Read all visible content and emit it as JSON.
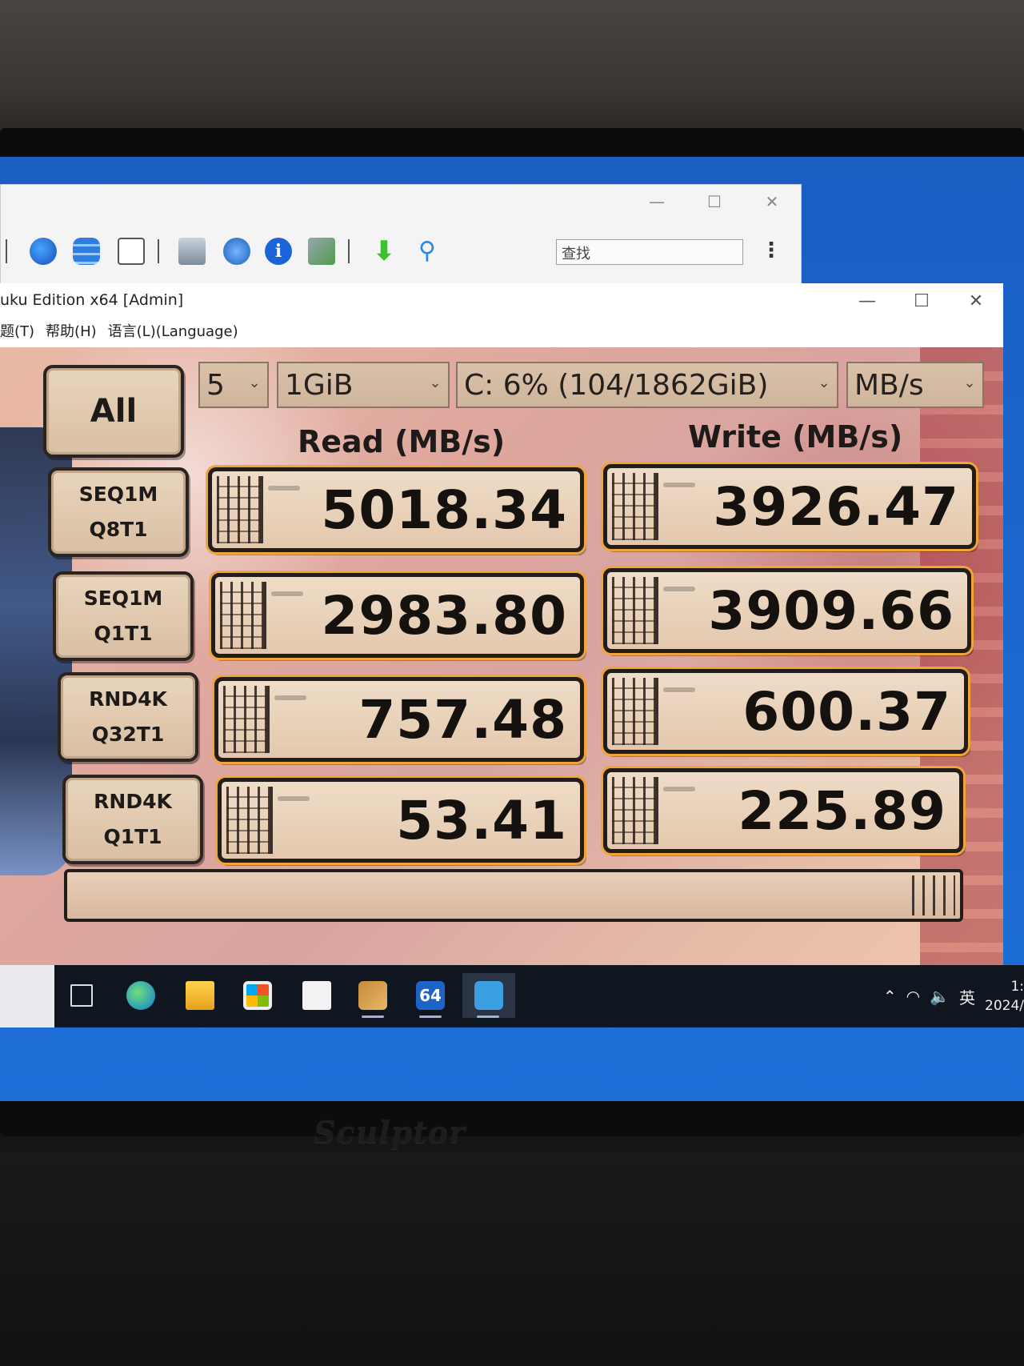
{
  "back_window": {
    "controls": {
      "minimize": "—",
      "maximize": "☐",
      "close": "✕"
    },
    "search_placeholder": "查找",
    "more": "⋮",
    "toolbar_icons": [
      "pie-chart-icon",
      "database-icon",
      "report-icon",
      "monitor-icon",
      "network-icon",
      "info-icon",
      "sync-icon",
      "download-icon",
      "search-icon"
    ]
  },
  "main_window": {
    "title": "uku Edition x64 [Admin]",
    "controls": {
      "minimize": "—",
      "maximize": "☐",
      "close": "✕"
    },
    "menu": [
      "题(T)",
      "帮助(H)",
      "语言(L)(Language)"
    ]
  },
  "benchmark": {
    "all_button": "All",
    "settings": {
      "count": "5",
      "size": "1GiB",
      "drive": "C: 6% (104/1862GiB)",
      "unit": "MB/s"
    },
    "headers": {
      "read": "Read (MB/s)",
      "write": "Write (MB/s)"
    },
    "tests": [
      {
        "line1": "SEQ1M",
        "line2": "Q8T1",
        "read": "5018.34",
        "write": "3926.47"
      },
      {
        "line1": "SEQ1M",
        "line2": "Q1T1",
        "read": "2983.80",
        "write": "3909.66"
      },
      {
        "line1": "RND4K",
        "line2": "Q32T1",
        "read": "757.48",
        "write": "600.37"
      },
      {
        "line1": "RND4K",
        "line2": "Q1T1",
        "read": "53.41",
        "write": "225.89"
      }
    ]
  },
  "taskbar": {
    "apps": [
      "task-view-icon",
      "edge-icon",
      "file-explorer-icon",
      "store-icon",
      "mail-icon",
      "package-icon",
      "aida64-icon",
      "crystaldiskmark-icon"
    ],
    "aida_label": "64",
    "tray": {
      "ime": "英",
      "time": "1:",
      "date": "2024/"
    }
  },
  "monitor": {
    "brand": "Sculptor"
  }
}
